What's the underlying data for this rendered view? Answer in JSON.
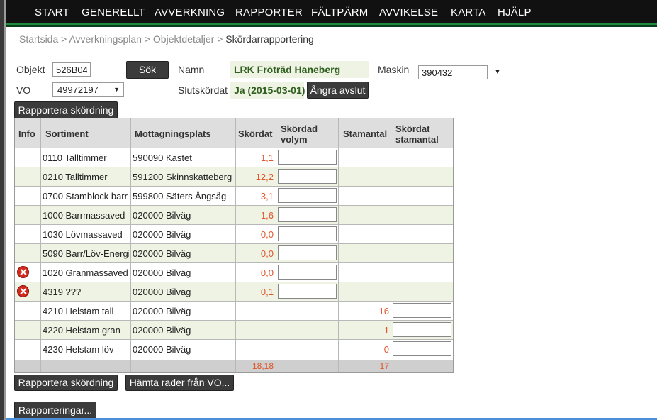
{
  "nav": {
    "items": [
      "START",
      "GENERELLT",
      "AVVERKNING",
      "RAPPORTER",
      "FÄLTPÄRM",
      "AVVIKELSE",
      "KARTA",
      "HJÄLP"
    ]
  },
  "breadcrumb": {
    "items": [
      "Startsida",
      "Avverkningsplan",
      "Objektdetaljer"
    ],
    "separator": ">",
    "current": "Skördarrapportering"
  },
  "form": {
    "objekt_label": "Objekt",
    "objekt_value": "526B04",
    "sok_label": "Sök",
    "namn_label": "Namn",
    "namn_value": "LRK Fröträd Haneberg",
    "maskin_label": "Maskin",
    "maskin_value": "390432",
    "vo_label": "VO",
    "vo_value": "49972197",
    "slutskordat_label": "Slutskördat",
    "slutskordat_value": "Ja (2015-03-01)",
    "angra_label": "Ångra avslut",
    "rapportera_top_label": "Rapportera skördning"
  },
  "table": {
    "headers": {
      "info": "Info",
      "sortiment": "Sortiment",
      "mottagningsplats": "Mottagningsplats",
      "skordat": "Skördat",
      "skordad_volym_1": "Skördad",
      "skordad_volym_2": "volym",
      "stamantal": "Stamantal",
      "skordat_stamantal_1": "Skördat",
      "skordat_stamantal_2": "stamantal"
    },
    "rows": [
      {
        "info": "",
        "sortiment": "0110 Talltimmer",
        "mottagningsplats": "590090 Kastet",
        "skordat": "1,1",
        "stamantal": ""
      },
      {
        "info": "",
        "sortiment": "0210 Talltimmer",
        "mottagningsplats": "591200 Skinnskatteberg",
        "skordat": "12,2",
        "stamantal": ""
      },
      {
        "info": "",
        "sortiment": "0700 Stamblock barr",
        "mottagningsplats": "599800 Säters Ångsåg",
        "skordat": "3,1",
        "stamantal": ""
      },
      {
        "info": "",
        "sortiment": "1000 Barrmassaved",
        "mottagningsplats": "020000 Bilväg",
        "skordat": "1,6",
        "stamantal": ""
      },
      {
        "info": "",
        "sortiment": "1030 Lövmassaved",
        "mottagningsplats": "020000 Bilväg",
        "skordat": "0,0",
        "stamantal": ""
      },
      {
        "info": "",
        "sortiment": "5090 Barr/Löv-Energi",
        "mottagningsplats": "020000 Bilväg",
        "skordat": "0,0",
        "stamantal": ""
      },
      {
        "info": "error-icon",
        "sortiment": "1020 Granmassaved",
        "mottagningsplats": "020000 Bilväg",
        "skordat": "0,0",
        "stamantal": ""
      },
      {
        "info": "error-icon",
        "sortiment": "4319 ???",
        "mottagningsplats": "020000 Bilväg",
        "skordat": "0,1",
        "stamantal": ""
      },
      {
        "info": "",
        "sortiment": "4210 Helstam tall",
        "mottagningsplats": "020000 Bilväg",
        "skordat": "",
        "stamantal": "16"
      },
      {
        "info": "",
        "sortiment": "4220 Helstam gran",
        "mottagningsplats": "020000 Bilväg",
        "skordat": "",
        "stamantal": "1"
      },
      {
        "info": "",
        "sortiment": "4230 Helstam löv",
        "mottagningsplats": "020000 Bilväg",
        "skordat": "",
        "stamantal": "0"
      }
    ],
    "totals": {
      "skordat": "18,18",
      "stamantal": "17"
    }
  },
  "actions": {
    "rapportera_label": "Rapportera skördning",
    "hamta_label": "Hämta rader från VO...",
    "rapporteringar_label": "Rapporteringar..."
  },
  "colors": {
    "nav_bg": "#111111",
    "nav_stripe": "#1e8a3c",
    "alt_row": "#eef3e4",
    "number_text": "#e0552a",
    "value_green": "#2f5f1f",
    "error_icon": "#d42a1e"
  }
}
